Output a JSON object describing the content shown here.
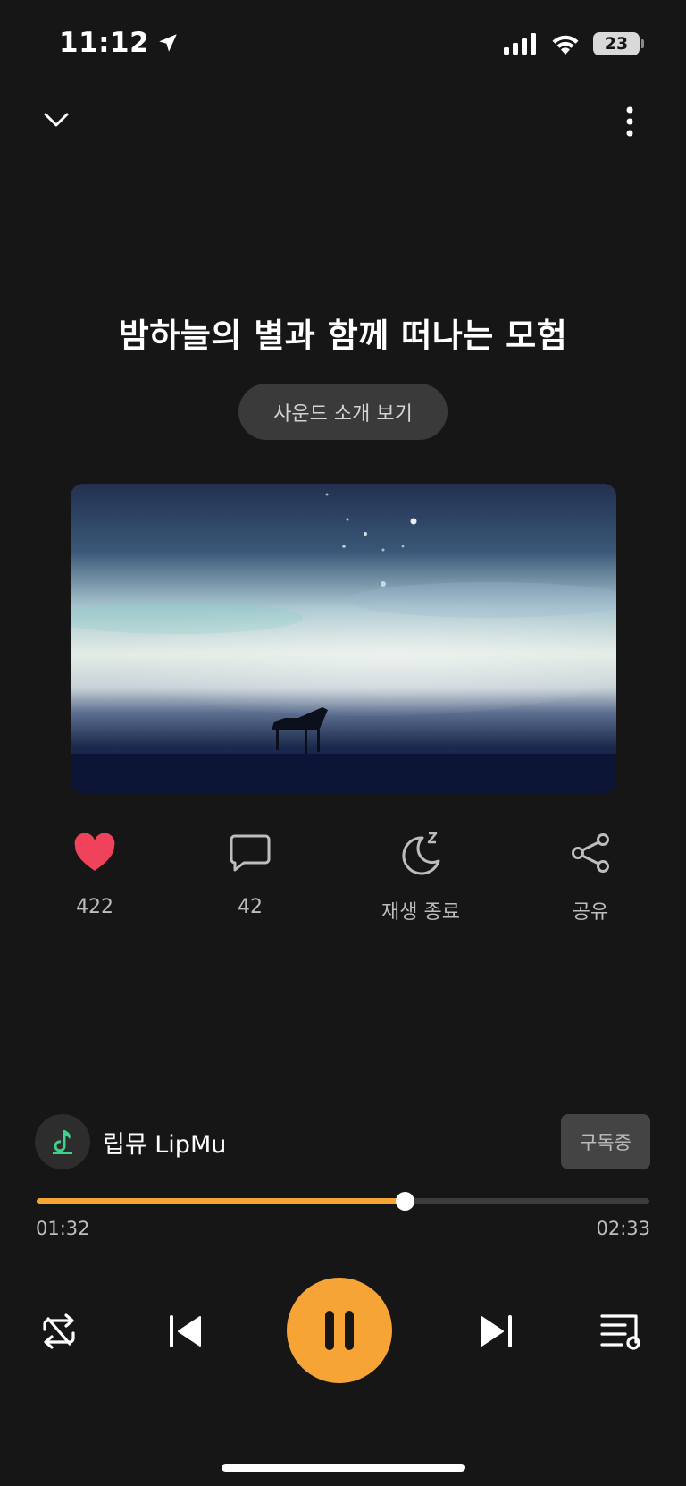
{
  "status_bar": {
    "time": "11:12",
    "battery": "23"
  },
  "track": {
    "title": "밤하늘의 별과 함께 떠나는 모험",
    "intro_button": "사운드 소개 보기"
  },
  "actions": {
    "likes": "422",
    "comments": "42",
    "sleep_timer": "재생 종료",
    "share": "공유"
  },
  "creator": {
    "name": "립뮤 LipMu",
    "subscribe_label": "구독중"
  },
  "player": {
    "elapsed": "01:32",
    "duration": "02:33",
    "progress": 0.601
  },
  "colors": {
    "background": "#161616",
    "accent": "#f6a436",
    "heart": "#f0425a"
  }
}
